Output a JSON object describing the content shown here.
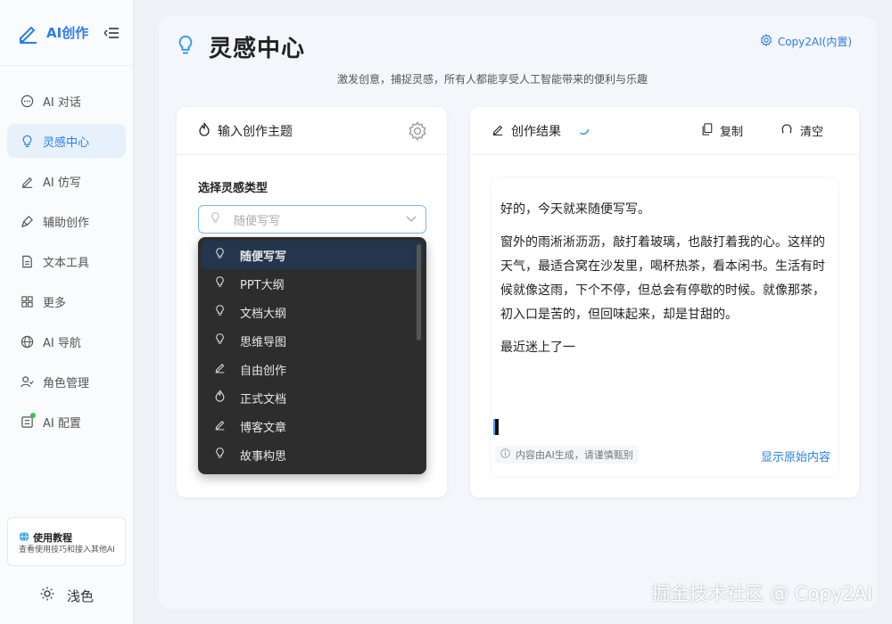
{
  "brand": {
    "name": "AI创作"
  },
  "sidebar": {
    "items": [
      {
        "label": "AI 对话",
        "icon": "chat-icon"
      },
      {
        "label": "灵感中心",
        "icon": "bulb-icon",
        "active": true
      },
      {
        "label": "AI 仿写",
        "icon": "pen-icon"
      },
      {
        "label": "辅助创作",
        "icon": "brush-icon"
      },
      {
        "label": "文本工具",
        "icon": "document-icon"
      },
      {
        "label": "更多",
        "icon": "grid-icon"
      },
      {
        "label": "AI 导航",
        "icon": "globe-icon"
      },
      {
        "label": "角色管理",
        "icon": "users-icon"
      },
      {
        "label": "AI 配置",
        "icon": "config-icon"
      }
    ],
    "tutorial": {
      "title": "使用教程",
      "subtitle": "查看使用技巧和接入其他AI"
    },
    "theme_label": "浅色"
  },
  "header": {
    "title": "灵感中心",
    "subtitle": "激发创意，捕捉灵感，所有人都能享受人工智能带来的便利与乐趣",
    "copy2ai": "Copy2AI(内置)"
  },
  "input_card": {
    "title": "输入创作主题",
    "select_label": "选择灵感类型",
    "select_placeholder": "随便写写",
    "options": [
      {
        "label": "随便写写",
        "icon": "bulb-icon"
      },
      {
        "label": "PPT大纲",
        "icon": "bulb-icon"
      },
      {
        "label": "文档大纲",
        "icon": "bulb-icon"
      },
      {
        "label": "思维导图",
        "icon": "bulb-icon"
      },
      {
        "label": "自由创作",
        "icon": "pen-icon"
      },
      {
        "label": "正式文档",
        "icon": "flame-icon"
      },
      {
        "label": "博客文章",
        "icon": "pen-icon"
      },
      {
        "label": "故事构思",
        "icon": "bulb-icon"
      }
    ]
  },
  "result_card": {
    "title": "创作结果",
    "copy_label": "复制",
    "clear_label": "清空",
    "paragraphs": [
      "好的，今天就来随便写写。",
      "窗外的雨淅淅沥沥，敲打着玻璃，也敲打着我的心。这样的天气，最适合窝在沙发里，喝杯热茶，看本闲书。生活有时候就像这雨，下个不停，但总会有停歇的时候。就像那茶，初入口是苦的，但回味起来，却是甘甜的。",
      "最近迷上了一"
    ],
    "ai_note": "内容由AI生成，请谨慎甄别",
    "show_original": "显示原始内容"
  },
  "watermark": "掘金技术社区 @ Copy2AI",
  "colors": {
    "accent": "#2b7de9",
    "dropdown_bg": "#2d2d2d",
    "active_bg": "#e6f1fb"
  }
}
